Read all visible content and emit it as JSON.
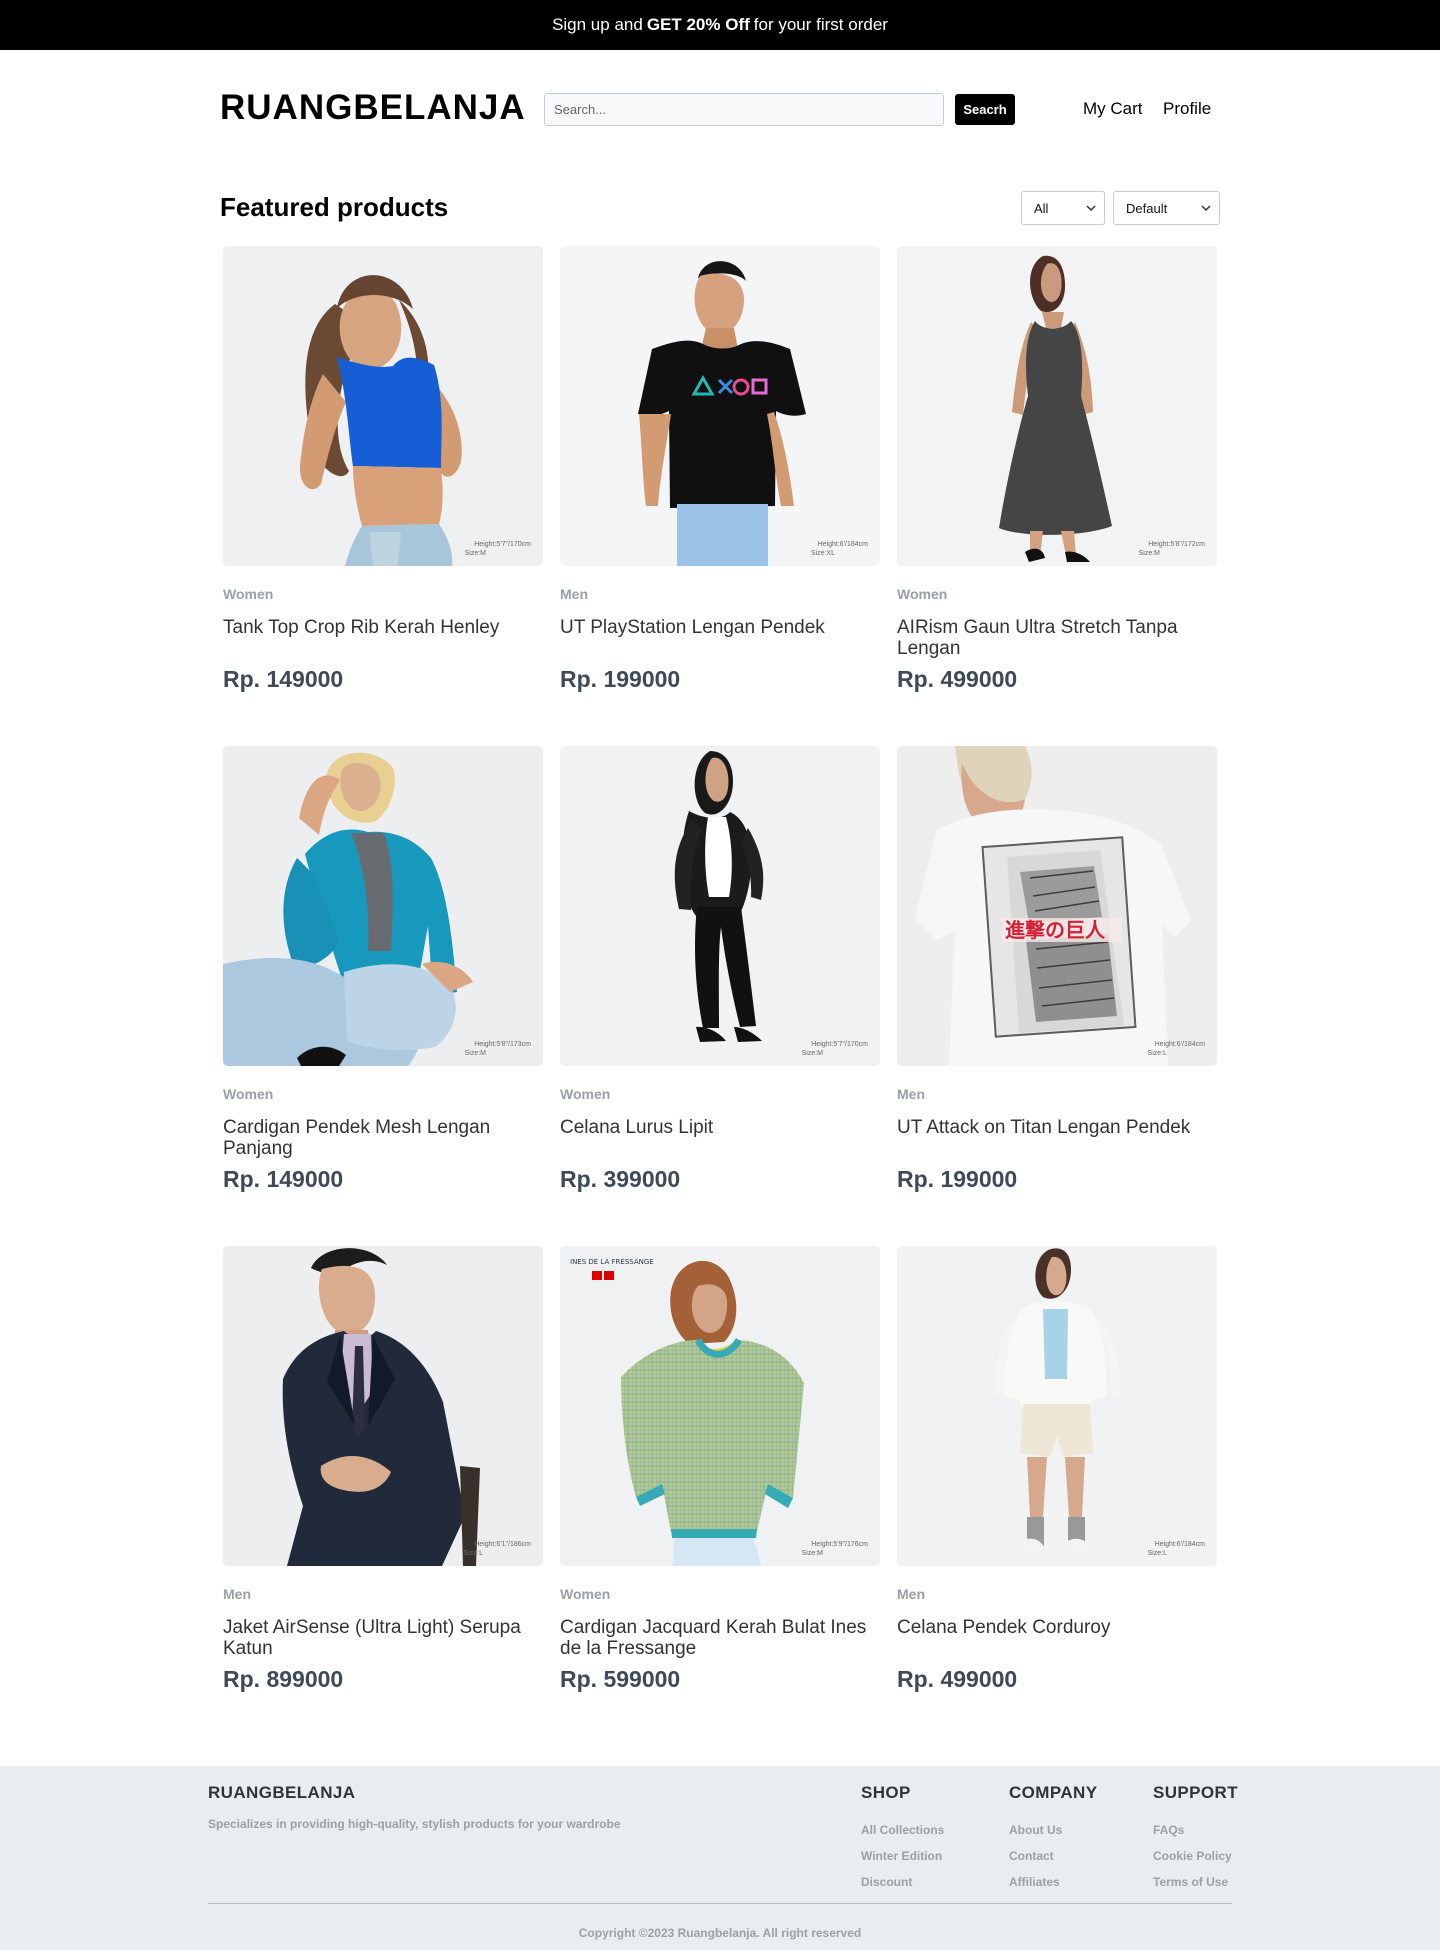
{
  "promo": {
    "prefix": "Sign up and",
    "highlight": "GET 20% Off",
    "suffix": "for your first order"
  },
  "header": {
    "brand": "RUANGBELANJA",
    "search_placeholder": "Search...",
    "search_label": "Seacrh",
    "cart_label": "My Cart",
    "profile_label": "Profile"
  },
  "section": {
    "title": "Featured products",
    "category_filter": "All",
    "sort_filter": "Default"
  },
  "products": [
    {
      "category": "Women",
      "name": "Tank Top Crop Rib Kerah Henley",
      "price": "Rp. 149000",
      "model_label": "Height:5'7\"/170cm",
      "size_label": "Size:M"
    },
    {
      "category": "Men",
      "name": "UT PlayStation Lengan Pendek",
      "price": "Rp. 199000",
      "model_label": "Height:6'/184cm",
      "size_label": "Size:XL"
    },
    {
      "category": "Women",
      "name": "AIRism Gaun Ultra Stretch Tanpa Lengan",
      "price": "Rp. 499000",
      "model_label": "Height:5'8\"/172cm",
      "size_label": "Size:M"
    },
    {
      "category": "Women",
      "name": "Cardigan Pendek Mesh Lengan Panjang",
      "price": "Rp. 149000",
      "model_label": "Height:5'8\"/173cm",
      "size_label": "Size:M"
    },
    {
      "category": "Women",
      "name": "Celana Lurus Lipit",
      "price": "Rp. 399000",
      "model_label": "Height:5'7\"/170cm",
      "size_label": "Size:M"
    },
    {
      "category": "Men",
      "name": "UT Attack on Titan Lengan Pendek",
      "price": "Rp. 199000",
      "model_label": "Height:6'/184cm",
      "size_label": "Size:L"
    },
    {
      "category": "Men",
      "name": "Jaket AirSense (Ultra Light) Serupa Katun",
      "price": "Rp. 899000",
      "model_label": "Height:6'1\"/186cm",
      "size_label": "Size:L"
    },
    {
      "category": "Women",
      "name": "Cardigan Jacquard Kerah Bulat Ines de la Fressange",
      "price": "Rp. 599000",
      "model_label": "Height:5'9\"/176cm",
      "size_label": "Size:M"
    },
    {
      "category": "Men",
      "name": "Celana Pendek Corduroy",
      "price": "Rp. 499000",
      "model_label": "Height:6'/184cm",
      "size_label": "Size:L"
    }
  ],
  "footer": {
    "brand": "RUANGBELANJA",
    "description": "Specializes in providing high-quality, stylish products for your wardrobe",
    "shop": {
      "heading": "SHOP",
      "links": [
        "All Collections",
        "Winter Edition",
        "Discount"
      ]
    },
    "company": {
      "heading": "COMPANY",
      "links": [
        "About Us",
        "Contact",
        "Affiliates"
      ]
    },
    "support": {
      "heading": "SUPPORT",
      "links": [
        "FAQs",
        "Cookie Policy",
        "Terms of Use"
      ]
    },
    "copyright": "Copyright ©2023 Ruangbelanja. All right reserved"
  },
  "colors": {
    "primary": "#000000",
    "muted": "#9aa0a6",
    "price": "#3f4a57",
    "footer_background": "#e9edf0",
    "image_background": "#f1f3f4"
  },
  "icons": {
    "select_indicator": "chevron-down-icon"
  }
}
